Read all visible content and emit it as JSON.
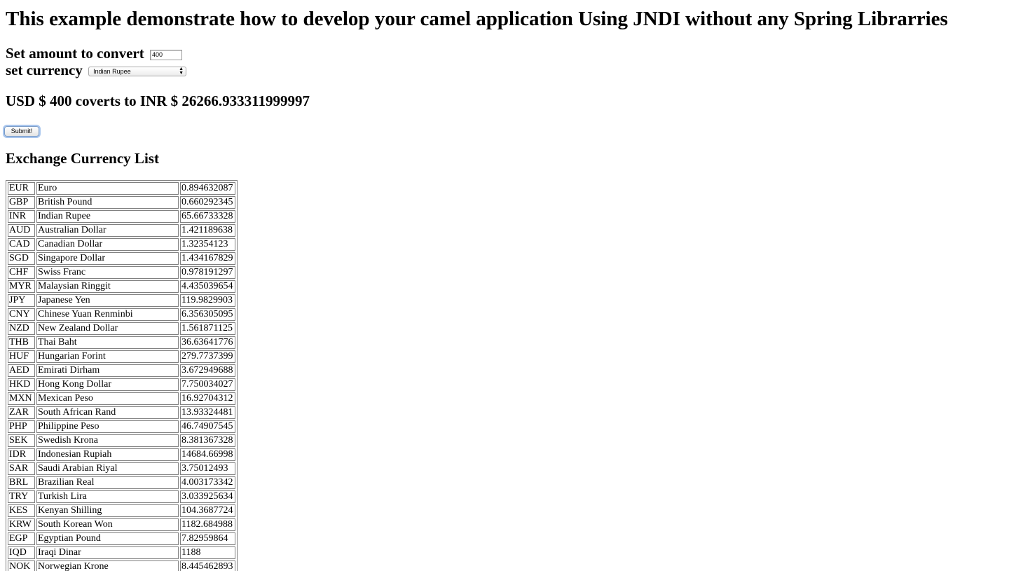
{
  "page": {
    "title": "This example demonstrate how to develop your camel application Using JNDI without any Spring Librarries"
  },
  "form": {
    "amount_label": "Set amount to convert",
    "amount_value": "400",
    "currency_label": "set currency",
    "currency_selected": "Indian Rupee",
    "submit_label": "Submit!"
  },
  "result": {
    "text": "USD $ 400 coverts to INR $ 26266.933311999997"
  },
  "list": {
    "heading": "Exchange Currency List",
    "rows": [
      {
        "code": "EUR",
        "name": "Euro",
        "rate": "0.894632087"
      },
      {
        "code": "GBP",
        "name": "British Pound",
        "rate": "0.660292345"
      },
      {
        "code": "INR",
        "name": "Indian Rupee",
        "rate": "65.66733328"
      },
      {
        "code": "AUD",
        "name": "Australian Dollar",
        "rate": "1.421189638"
      },
      {
        "code": "CAD",
        "name": "Canadian Dollar",
        "rate": "1.32354123"
      },
      {
        "code": "SGD",
        "name": "Singapore Dollar",
        "rate": "1.434167829"
      },
      {
        "code": "CHF",
        "name": "Swiss Franc",
        "rate": "0.978191297"
      },
      {
        "code": "MYR",
        "name": "Malaysian Ringgit",
        "rate": "4.435039654"
      },
      {
        "code": "JPY",
        "name": "Japanese Yen",
        "rate": "119.9829903"
      },
      {
        "code": "CNY",
        "name": "Chinese Yuan Renminbi",
        "rate": "6.356305095"
      },
      {
        "code": "NZD",
        "name": "New Zealand Dollar",
        "rate": "1.561871125"
      },
      {
        "code": "THB",
        "name": "Thai Baht",
        "rate": "36.63641776"
      },
      {
        "code": "HUF",
        "name": "Hungarian Forint",
        "rate": "279.7737399"
      },
      {
        "code": "AED",
        "name": "Emirati Dirham",
        "rate": "3.672949688"
      },
      {
        "code": "HKD",
        "name": "Hong Kong Dollar",
        "rate": "7.750034027"
      },
      {
        "code": "MXN",
        "name": "Mexican Peso",
        "rate": "16.92704312"
      },
      {
        "code": "ZAR",
        "name": "South African Rand",
        "rate": "13.93324481"
      },
      {
        "code": "PHP",
        "name": "Philippine Peso",
        "rate": "46.74907545"
      },
      {
        "code": "SEK",
        "name": "Swedish Krona",
        "rate": "8.381367328"
      },
      {
        "code": "IDR",
        "name": "Indonesian Rupiah",
        "rate": "14684.66998"
      },
      {
        "code": "SAR",
        "name": "Saudi Arabian Riyal",
        "rate": "3.75012493"
      },
      {
        "code": "BRL",
        "name": "Brazilian Real",
        "rate": "4.003173342"
      },
      {
        "code": "TRY",
        "name": "Turkish Lira",
        "rate": "3.033925634"
      },
      {
        "code": "KES",
        "name": "Kenyan Shilling",
        "rate": "104.3687724"
      },
      {
        "code": "KRW",
        "name": "South Korean Won",
        "rate": "1182.684988"
      },
      {
        "code": "EGP",
        "name": "Egyptian Pound",
        "rate": "7.82959864"
      },
      {
        "code": "IQD",
        "name": "Iraqi Dinar",
        "rate": "1188"
      },
      {
        "code": "NOK",
        "name": "Norwegian Krone",
        "rate": "8.445462893"
      }
    ]
  }
}
